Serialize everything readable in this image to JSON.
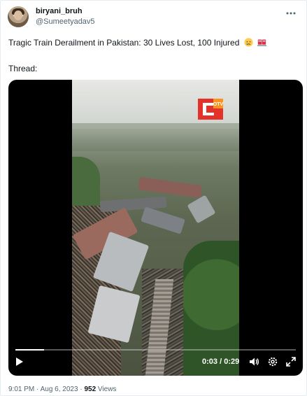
{
  "tweet": {
    "author_name": "biryani_bruh",
    "author_handle": "@Sumeetyadav5",
    "more_icon": "more-options-icon",
    "text": "Tragic Train Derailment in Pakistan: 30 Lives Lost, 100 Injured",
    "emojis": [
      "crying-face-emoji",
      "train-emoji"
    ],
    "thread_label": "Thread:"
  },
  "video": {
    "watermark": "OTV",
    "progress": 0.103,
    "time_current": "0:03",
    "time_separator": "/",
    "time_total": "0:29",
    "icons": [
      "play-icon",
      "volume-icon",
      "settings-icon",
      "fullscreen-icon"
    ]
  },
  "meta": {
    "time": "9:01 PM",
    "separator": "·",
    "date": "Aug 6, 2023",
    "views_count": "952",
    "views_label": "Views"
  },
  "colors": {
    "text_primary": "#0f1419",
    "text_secondary": "#536471",
    "logo_red": "#e4322b",
    "logo_orange": "#f7931e"
  }
}
